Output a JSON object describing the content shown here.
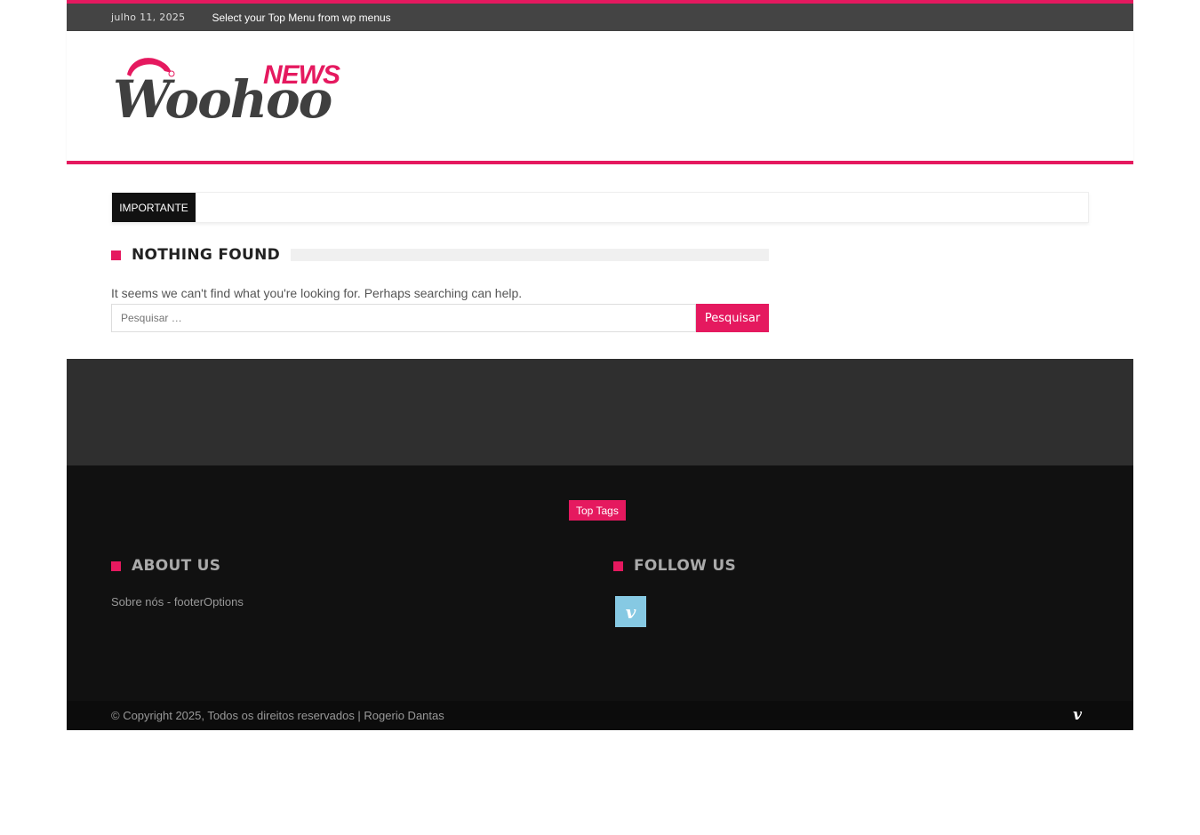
{
  "topbar": {
    "date": "julho 11, 2025",
    "menu_note": "Select your Top Menu from wp menus"
  },
  "logo": {
    "wordmark": "Woohoo",
    "tag": "NEWS"
  },
  "ticker": {
    "label": "IMPORTANTE"
  },
  "content": {
    "section_title": "NOTHING FOUND",
    "message": "It seems we can't find what you're looking for. Perhaps searching can help.",
    "search_placeholder": "Pesquisar …",
    "search_button": "Pesquisar"
  },
  "footer": {
    "top_tags": "Top Tags",
    "about_title": "ABOUT US",
    "about_text": "Sobre nós - footerOptions",
    "follow_title": "FOLLOW US",
    "social_icon": "vimeo-icon",
    "social_glyph": "v",
    "copyright": "© Copyright 2025, Todos os direitos reservados | Rogerio Dantas"
  },
  "colors": {
    "accent": "#e5195f",
    "topbar": "#444444",
    "footer_dark": "#111111",
    "footer_mid": "#2f2f2f",
    "vimeo": "#86c9e3"
  }
}
